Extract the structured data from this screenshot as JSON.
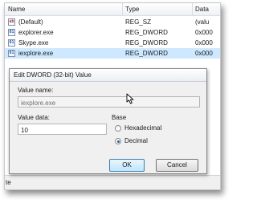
{
  "registry": {
    "columns": {
      "name": "Name",
      "type": "Type",
      "data": "Data"
    },
    "rows": [
      {
        "icon": "string-value-icon",
        "name": "(Default)",
        "type": "REG_SZ",
        "data": "(valu"
      },
      {
        "icon": "binary-value-icon",
        "name": "explorer.exe",
        "type": "REG_DWORD",
        "data": "0x000"
      },
      {
        "icon": "binary-value-icon",
        "name": "Skype.exe",
        "type": "REG_DWORD",
        "data": "0x000"
      },
      {
        "icon": "binary-value-icon",
        "name": "iexplore.exe",
        "type": "REG_DWORD",
        "data": "0x000"
      }
    ],
    "bottom_text": "te"
  },
  "dialog": {
    "title": "Edit DWORD (32-bit) Value",
    "value_name_label": "Value name:",
    "value_name": "iexplore.exe",
    "value_data_label": "Value data:",
    "value_data": "10",
    "base_label": "Base",
    "base_options": [
      {
        "label": "Hexadecimal",
        "selected": false
      },
      {
        "label": "Decimal",
        "selected": true
      }
    ],
    "ok_label": "OK",
    "cancel_label": "Cancel"
  }
}
